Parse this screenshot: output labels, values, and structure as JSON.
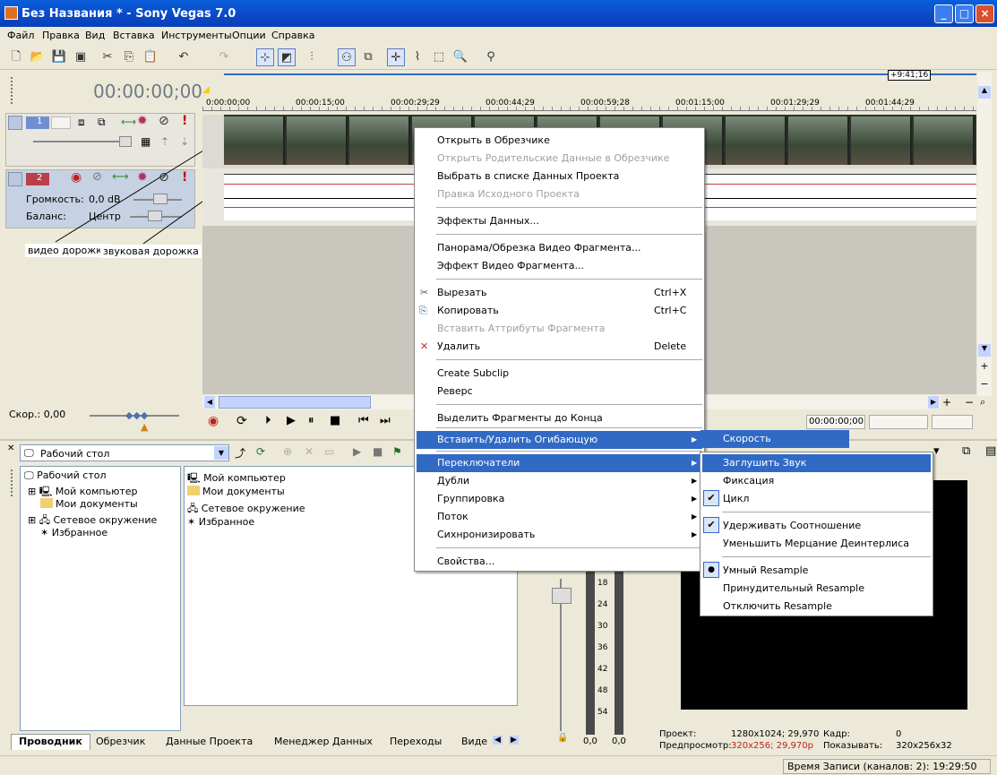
{
  "window": {
    "title": "Без Названия * - Sony Vegas 7.0",
    "minimize": "_",
    "maximize": "□",
    "close": "×"
  },
  "menubar": [
    "Файл",
    "Правка",
    "Вид",
    "Вставка",
    "Инструменты",
    "Опции",
    "Справка"
  ],
  "toolbar_icons": [
    "new-icon",
    "open-icon",
    "save-icon",
    "render-icon",
    "cut-icon",
    "copy-icon",
    "paste-icon",
    "undo-icon",
    "redo-icon",
    "snap-icon",
    "auto-crossfade-icon",
    "ripple-icon",
    "lock-envelope-icon",
    "ignore-grouping-icon",
    "normal-edit-icon",
    "envelope-edit-icon",
    "selection-edit-icon",
    "zoom-icon",
    "whats-this-icon"
  ],
  "timecode": "00:00:00;00",
  "ruler": {
    "labels": [
      "0:00:00;00",
      "00:00:15;00",
      "00:00:29;29",
      "00:00:44;29",
      "00:00:59;28",
      "00:01:15;00",
      "00:01:29;29",
      "00:01:44;29"
    ],
    "marker": "+9:41;16"
  },
  "tracks": {
    "video": {
      "num": "1"
    },
    "audio": {
      "num": "2",
      "volume_label": "Громкость:",
      "volume": "0,0 dB",
      "balance_label": "Баланс:",
      "balance": "Центр"
    }
  },
  "annotations": {
    "video": "видео дорожка",
    "audio": "звуковая дорожка"
  },
  "rate": "Скор.: 0,00",
  "transport_time": "00:00:00;00",
  "explorer": {
    "path": "Рабочий стол",
    "tree": [
      "Рабочий стол",
      "Мой компьютер",
      "Мои документы",
      "Сетевое окружение",
      "Избранное"
    ],
    "files": [
      "Мой компьютер",
      "Мои документы",
      "Сетевое окружение",
      "Избранное"
    ]
  },
  "tabs": [
    "Проводник",
    "Обрезчик",
    "Данные Проекта",
    "Менеджер Данных",
    "Переходы",
    "Виде"
  ],
  "meter_labels": [
    "18",
    "24",
    "30",
    "36",
    "42",
    "48",
    "54"
  ],
  "meter_values": [
    "0,0",
    "0,0"
  ],
  "preview": {
    "project_label": "Проект:",
    "project": "1280x1024; 29,970",
    "frame_label": "Кадр:",
    "frame": "0",
    "preview_label": "Предпросмотр:",
    "preview": "320x256; 29,970p",
    "display_label": "Показывать:",
    "display": "320x256x32"
  },
  "statusbar": "Время Записи (каналов: 2): 19:29:50",
  "context_menu": {
    "items": [
      {
        "label": "Открыть в Обрезчике",
        "disabled": false
      },
      {
        "label": "Открыть Родительские Данные в Обрезчике",
        "disabled": true
      },
      {
        "label": "Выбрать в списке Данных Проекта",
        "disabled": false
      },
      {
        "label": "Правка Исходного Проекта",
        "disabled": true
      },
      {
        "label": "Эффекты Данных...",
        "disabled": false
      },
      {
        "label": "Панорама/Обрезка Видео Фрагмента...",
        "disabled": false
      },
      {
        "label": "Эффект Видео Фрагмента...",
        "disabled": false
      },
      {
        "label": "Вырезать",
        "shortcut": "Ctrl+X",
        "disabled": false
      },
      {
        "label": "Копировать",
        "shortcut": "Ctrl+C",
        "disabled": false
      },
      {
        "label": "Вставить Аттрибуты Фрагмента",
        "disabled": true
      },
      {
        "label": "Удалить",
        "shortcut": "Delete",
        "disabled": false
      },
      {
        "label": "Create Subclip",
        "disabled": false
      },
      {
        "label": "Реверс",
        "disabled": false
      },
      {
        "label": "Выделить Фрагменты до Конца",
        "disabled": false
      },
      {
        "label": "Вставить/Удалить Огибающую",
        "submenu": true,
        "disabled": false
      },
      {
        "label": "Переключатели",
        "submenu": true,
        "selected": true,
        "disabled": false
      },
      {
        "label": "Дубли",
        "submenu": true,
        "disabled": false
      },
      {
        "label": "Группировка",
        "submenu": true,
        "disabled": false
      },
      {
        "label": "Поток",
        "submenu": true,
        "disabled": false
      },
      {
        "label": "Сихнронизировать",
        "submenu": true,
        "disabled": false
      },
      {
        "label": "Свойства...",
        "disabled": false
      }
    ]
  },
  "envelope_submenu": {
    "items": [
      {
        "label": "Скорость"
      }
    ]
  },
  "switches_submenu": {
    "items": [
      {
        "label": "Заглушить Звук",
        "selected": true
      },
      {
        "label": "Фиксация"
      },
      {
        "label": "Цикл",
        "checked": true
      },
      {
        "label": "Удерживать Соотношение",
        "checked": true
      },
      {
        "label": "Уменьшить Мерцание Деинтерлиса"
      },
      {
        "label": "Умный Resample",
        "radio": true
      },
      {
        "label": "Принудительный Resample"
      },
      {
        "label": "Отключить Resample"
      }
    ]
  }
}
